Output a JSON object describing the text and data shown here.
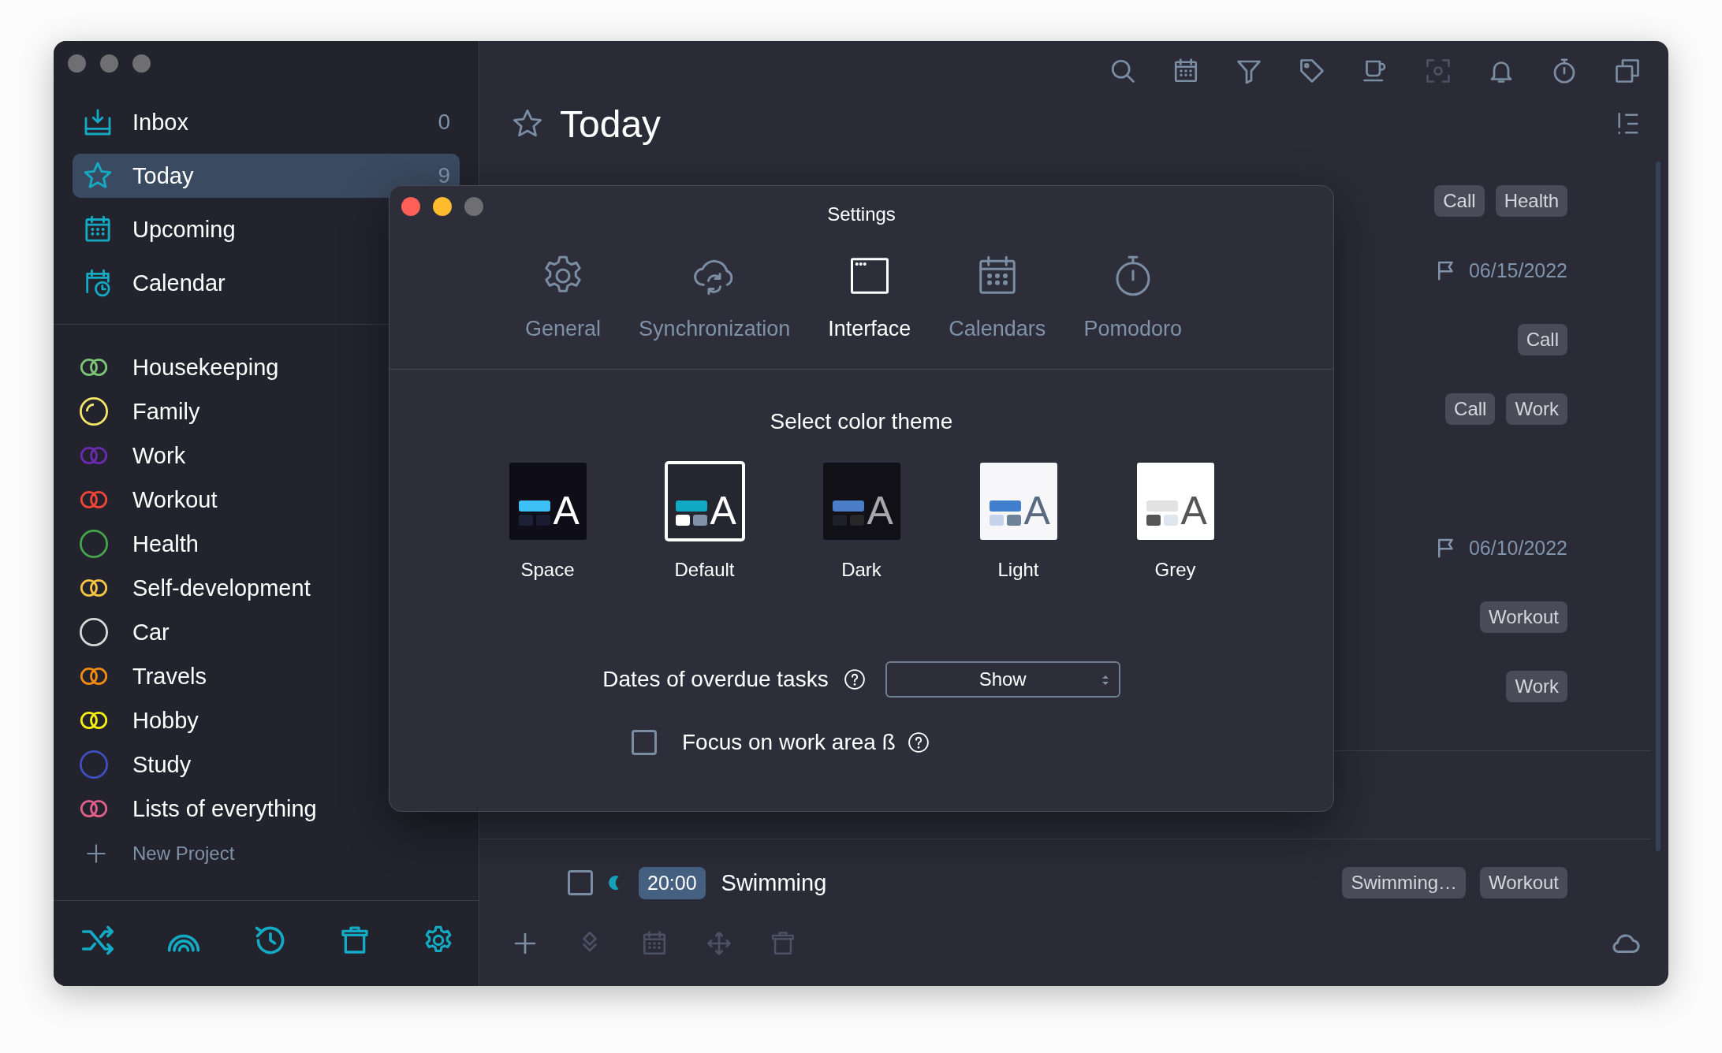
{
  "sidebar": {
    "nav": [
      {
        "label": "Inbox",
        "count": "0",
        "selected": false
      },
      {
        "label": "Today",
        "count": "9",
        "selected": true
      },
      {
        "label": "Upcoming",
        "selected": false
      },
      {
        "label": "Calendar",
        "selected": false
      }
    ],
    "projects": [
      {
        "name": "Housekeeping",
        "kind": "shared",
        "color": "#7cc576"
      },
      {
        "name": "Family",
        "kind": "partial",
        "color": "#f5e46a"
      },
      {
        "name": "Work",
        "kind": "shared",
        "color": "#6a2bb0"
      },
      {
        "name": "Workout",
        "kind": "shared",
        "color": "#ef4438"
      },
      {
        "name": "Health",
        "kind": "single",
        "color": "#45a34a"
      },
      {
        "name": "Self-development",
        "kind": "shared",
        "color": "#f6c343"
      },
      {
        "name": "Car",
        "kind": "single",
        "color": "#d8d8d8"
      },
      {
        "name": "Travels",
        "kind": "shared",
        "color": "#f38b12"
      },
      {
        "name": "Hobby",
        "kind": "shared",
        "color": "#f5ee10"
      },
      {
        "name": "Study",
        "kind": "single",
        "color": "#3f4fc0"
      },
      {
        "name": "Lists of everything",
        "kind": "shared",
        "color": "#e0608a"
      }
    ],
    "new_project": "New Project"
  },
  "main": {
    "title": "Today",
    "task_groups": [
      {
        "tasks": [
          {
            "tags": [
              "Call",
              "Health"
            ]
          },
          {
            "date": "06/15/2022"
          },
          {
            "tags": [
              "Call"
            ]
          },
          {
            "tags": [
              "Call",
              "Work"
            ]
          }
        ]
      },
      {
        "tasks": [
          {
            "date": "06/10/2022"
          },
          {
            "tags": [
              "Workout"
            ]
          },
          {
            "tags": [
              "Work"
            ]
          }
        ]
      }
    ],
    "current_task": {
      "checked": false,
      "time": "20:00",
      "title": "Swimming",
      "tags": [
        "Swimming…",
        "Workout"
      ]
    }
  },
  "settings": {
    "title": "Settings",
    "tabs": [
      {
        "label": "General",
        "selected": false
      },
      {
        "label": "Synchronization",
        "selected": false
      },
      {
        "label": "Interface",
        "selected": true
      },
      {
        "label": "Calendars",
        "selected": false
      },
      {
        "label": "Pomodoro",
        "selected": false
      }
    ],
    "theme_heading": "Select color theme",
    "themes": [
      {
        "name": "Space",
        "kind": "space",
        "sample": "A",
        "selected": false
      },
      {
        "name": "Default",
        "kind": "default",
        "sample": "A",
        "selected": true
      },
      {
        "name": "Dark",
        "kind": "dark",
        "sample": "A",
        "selected": false
      },
      {
        "name": "Light",
        "kind": "light",
        "sample": "A",
        "selected": false
      },
      {
        "name": "Grey",
        "kind": "grey",
        "sample": "A",
        "selected": false
      }
    ],
    "overdue_dates": {
      "label": "Dates of overdue tasks",
      "value": "Show"
    },
    "focus": {
      "label": "Focus on work area ß",
      "checked": false
    }
  }
}
